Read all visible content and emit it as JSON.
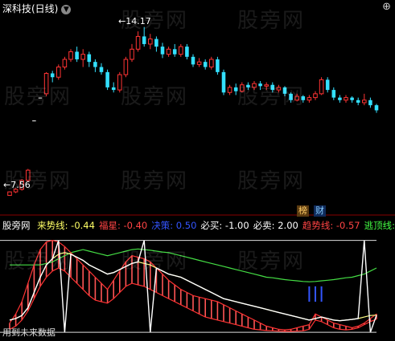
{
  "header": {
    "title": "深科技(日线)",
    "menu_icon": "chevron-down-icon"
  },
  "annotations": {
    "high_label": "14.17",
    "low_label": "7.56"
  },
  "badges": {
    "badge1": "榜",
    "badge2": "财"
  },
  "indicator": {
    "name": "股旁网",
    "values": [
      {
        "label": "来势线:",
        "value": "-0.44",
        "color": "#ffff66"
      },
      {
        "label": "福星:",
        "value": "-0.40",
        "color": "#ff4444"
      },
      {
        "label": "决策:",
        "value": "0.50",
        "color": "#3355ff"
      },
      {
        "label": "必买:",
        "value": "-1.00",
        "color": "#ffffff"
      },
      {
        "label": "必卖:",
        "value": "2.00",
        "color": "#ffffff"
      },
      {
        "label": "趋势线:",
        "value": "-0.57",
        "color": "#ff4444"
      },
      {
        "label": "逃顶线:",
        "value": "",
        "color": "#44ff44"
      }
    ]
  },
  "footer": "用到未来数据",
  "watermark": "股旁网",
  "colors": {
    "up": "#ff3333",
    "down": "#33e0ff",
    "flat": "#ffffff",
    "line_yellow": "#ffff88",
    "line_red": "#ff3333",
    "line_green": "#44dd44",
    "line_white": "#ffffff",
    "stick_blue": "#3355ff"
  },
  "chart_data": [
    {
      "type": "candlestick",
      "title": "深科技(日线)",
      "ylim": [
        7.2,
        14.6
      ],
      "annotated_high": 14.17,
      "annotated_low": 7.56,
      "candles": [
        [
          7.56,
          7.7,
          7.56,
          7.72
        ],
        [
          7.7,
          7.8,
          7.65,
          7.85
        ],
        [
          7.8,
          8.15,
          7.75,
          8.2
        ],
        [
          8.15,
          8.55,
          8.1,
          8.6
        ],
        [
          10.5,
          10.5,
          10.5,
          10.5
        ],
        [
          11.4,
          11.4,
          11.4,
          11.4
        ],
        [
          11.55,
          12.35,
          11.45,
          12.4
        ],
        [
          12.35,
          12.2,
          12.0,
          12.45
        ],
        [
          12.2,
          12.6,
          12.1,
          12.7
        ],
        [
          12.6,
          12.9,
          12.5,
          13.0
        ],
        [
          12.9,
          13.2,
          12.8,
          13.3
        ],
        [
          13.2,
          12.9,
          12.8,
          13.4
        ],
        [
          12.9,
          13.1,
          12.6,
          13.3
        ],
        [
          13.1,
          12.8,
          12.6,
          13.2
        ],
        [
          12.8,
          12.6,
          12.4,
          12.9
        ],
        [
          12.6,
          12.4,
          12.3,
          12.75
        ],
        [
          12.4,
          11.8,
          11.7,
          12.5
        ],
        [
          11.8,
          11.7,
          11.6,
          12.0
        ],
        [
          11.7,
          12.3,
          11.6,
          12.4
        ],
        [
          12.3,
          12.9,
          12.2,
          13.0
        ],
        [
          12.9,
          13.3,
          12.8,
          13.5
        ],
        [
          13.3,
          13.8,
          13.2,
          14.0
        ],
        [
          13.8,
          13.5,
          13.4,
          14.17
        ],
        [
          13.5,
          13.7,
          13.3,
          13.9
        ],
        [
          13.7,
          13.4,
          13.2,
          13.8
        ],
        [
          13.4,
          13.1,
          12.95,
          13.55
        ],
        [
          13.1,
          13.3,
          13.0,
          13.4
        ],
        [
          13.3,
          13.1,
          13.0,
          13.5
        ],
        [
          13.1,
          13.4,
          13.0,
          13.5
        ],
        [
          13.4,
          13.0,
          12.9,
          13.5
        ],
        [
          13.0,
          12.7,
          12.6,
          13.1
        ],
        [
          12.7,
          12.8,
          12.6,
          12.95
        ],
        [
          12.8,
          12.6,
          12.5,
          12.9
        ],
        [
          12.6,
          12.9,
          12.5,
          13.0
        ],
        [
          12.9,
          12.4,
          12.3,
          13.0
        ],
        [
          12.4,
          11.6,
          11.5,
          12.5
        ],
        [
          11.6,
          11.8,
          11.5,
          11.9
        ],
        [
          11.8,
          11.65,
          11.5,
          11.95
        ],
        [
          11.65,
          11.9,
          11.6,
          12.0
        ],
        [
          11.9,
          11.8,
          11.7,
          12.0
        ],
        [
          11.8,
          11.95,
          11.7,
          12.05
        ],
        [
          11.95,
          11.85,
          11.7,
          12.05
        ],
        [
          11.85,
          11.9,
          11.7,
          12.0
        ],
        [
          11.9,
          11.7,
          11.6,
          12.0
        ],
        [
          11.7,
          11.8,
          11.6,
          11.9
        ],
        [
          11.8,
          11.55,
          11.45,
          11.85
        ],
        [
          11.55,
          11.3,
          11.2,
          11.6
        ],
        [
          11.3,
          11.45,
          11.25,
          11.55
        ],
        [
          11.45,
          11.3,
          11.2,
          11.5
        ],
        [
          11.3,
          11.4,
          11.2,
          11.5
        ],
        [
          11.4,
          11.55,
          11.3,
          11.65
        ],
        [
          11.55,
          12.1,
          11.5,
          12.2
        ],
        [
          12.1,
          11.7,
          11.6,
          12.2
        ],
        [
          11.7,
          11.4,
          11.3,
          11.8
        ],
        [
          11.4,
          11.3,
          11.2,
          11.5
        ],
        [
          11.3,
          11.4,
          11.2,
          11.5
        ],
        [
          11.4,
          11.3,
          11.2,
          11.45
        ],
        [
          11.3,
          11.2,
          11.1,
          11.4
        ],
        [
          11.2,
          11.3,
          11.1,
          11.55
        ],
        [
          11.3,
          11.1,
          11.0,
          11.4
        ],
        [
          11.1,
          10.9,
          10.8,
          11.15
        ]
      ]
    },
    {
      "type": "line",
      "title": "股旁网",
      "ylim": [
        -1.1,
        2.2
      ],
      "series": [
        {
          "name": "来势线",
          "values": [
            -0.6,
            -0.55,
            -0.45,
            -0.2,
            0.3,
            0.8,
            1.2,
            1.4,
            1.55,
            1.6,
            1.55,
            1.45,
            1.35,
            1.2,
            1.1,
            1.0,
            0.9,
            0.95,
            1.05,
            1.15,
            1.25,
            1.3,
            1.25,
            1.2,
            1.1,
            1.0,
            0.9,
            0.85,
            0.8,
            0.7,
            0.6,
            0.5,
            0.4,
            0.3,
            0.2,
            0.1,
            0.05,
            0.0,
            -0.05,
            -0.1,
            -0.15,
            -0.2,
            -0.25,
            -0.3,
            -0.35,
            -0.4,
            -0.45,
            -0.5,
            -0.55,
            -0.6,
            -0.55,
            -0.5,
            -0.55,
            -0.6,
            -0.62,
            -0.6,
            -0.58,
            -0.55,
            -0.5,
            -0.45,
            -0.44
          ]
        },
        {
          "name": "福星",
          "values": [
            -0.7,
            -0.4,
            0.0,
            0.6,
            1.2,
            1.7,
            1.95,
            2.0,
            1.95,
            1.8,
            1.6,
            1.4,
            1.2,
            1.0,
            0.8,
            0.6,
            0.4,
            0.7,
            1.0,
            1.3,
            1.5,
            1.45,
            1.4,
            1.3,
            1.1,
            0.9,
            0.7,
            0.55,
            0.4,
            0.3,
            0.2,
            0.15,
            0.1,
            0.05,
            0.0,
            -0.1,
            -0.2,
            -0.3,
            -0.4,
            -0.5,
            -0.6,
            -0.7,
            -0.8,
            -0.85,
            -0.9,
            -0.92,
            -0.9,
            -0.85,
            -0.8,
            -0.75,
            -0.4,
            -0.5,
            -0.6,
            -0.7,
            -0.75,
            -0.8,
            -0.85,
            -0.8,
            -0.7,
            -0.55,
            -0.4
          ]
        },
        {
          "name": "趋势线",
          "values": [
            -0.9,
            -0.8,
            -0.6,
            -0.3,
            0.1,
            0.5,
            0.8,
            1.0,
            1.1,
            1.0,
            0.8,
            0.6,
            0.4,
            0.2,
            0.05,
            0.0,
            -0.05,
            0.1,
            0.3,
            0.5,
            0.6,
            0.55,
            0.5,
            0.4,
            0.3,
            0.2,
            0.1,
            0.0,
            -0.1,
            -0.2,
            -0.3,
            -0.4,
            -0.5,
            -0.55,
            -0.6,
            -0.65,
            -0.7,
            -0.75,
            -0.8,
            -0.85,
            -0.9,
            -0.92,
            -0.94,
            -0.95,
            -0.96,
            -0.97,
            -0.97,
            -0.96,
            -0.95,
            -0.9,
            -0.6,
            -0.65,
            -0.75,
            -0.85,
            -0.9,
            -0.92,
            -0.9,
            -0.85,
            -0.75,
            -0.65,
            -0.57
          ]
        },
        {
          "name": "逃顶线",
          "values": [
            1.2,
            1.2,
            1.2,
            1.2,
            1.2,
            1.2,
            1.25,
            1.3,
            1.4,
            1.5,
            1.6,
            1.65,
            1.7,
            1.65,
            1.6,
            1.55,
            1.5,
            1.55,
            1.6,
            1.65,
            1.7,
            1.72,
            1.7,
            1.68,
            1.65,
            1.62,
            1.6,
            1.55,
            1.5,
            1.45,
            1.4,
            1.35,
            1.3,
            1.25,
            1.2,
            1.15,
            1.1,
            1.05,
            1.0,
            0.95,
            0.9,
            0.85,
            0.8,
            0.78,
            0.75,
            0.72,
            0.7,
            0.68,
            0.66,
            0.65,
            0.66,
            0.68,
            0.7,
            0.72,
            0.75,
            0.78,
            0.8,
            0.85,
            0.9,
            1.0,
            1.1
          ]
        },
        {
          "name": "必买",
          "values": [
            -1.0,
            -1.0,
            -1.0,
            -1.0,
            -1.0,
            -1.0,
            -1.0,
            -1.0,
            -1.0,
            -1.0,
            -1.0,
            -1.0,
            -1.0,
            -1.0,
            -1.0,
            -1.0,
            -1.0,
            -1.0,
            -1.0,
            -1.0,
            -1.0,
            -1.0,
            -1.0,
            -1.0,
            -1.0,
            -1.0,
            -1.0,
            -1.0,
            -1.0,
            -1.0,
            -1.0,
            -1.0,
            -1.0,
            -1.0,
            -1.0,
            -1.0,
            -1.0,
            -1.0,
            -1.0,
            -1.0,
            -1.0,
            -1.0,
            -1.0,
            -1.0,
            -1.0,
            -1.0,
            -1.0,
            -1.0,
            -1.0,
            -1.0,
            -1.0,
            -1.0,
            -1.0,
            -1.0,
            -1.0,
            -1.0,
            -1.0,
            -1.0,
            -1.0,
            -1.0,
            -1.0
          ]
        },
        {
          "name": "必卖",
          "values": [
            2.0,
            2.0,
            2.0,
            2.0,
            2.0,
            2.0,
            2.0,
            2.0,
            2.0,
            2.0,
            2.0,
            2.0,
            2.0,
            2.0,
            2.0,
            2.0,
            2.0,
            2.0,
            2.0,
            2.0,
            2.0,
            2.0,
            2.0,
            2.0,
            2.0,
            2.0,
            2.0,
            2.0,
            2.0,
            2.0,
            2.0,
            2.0,
            2.0,
            2.0,
            2.0,
            2.0,
            2.0,
            2.0,
            2.0,
            2.0,
            2.0,
            2.0,
            2.0,
            2.0,
            2.0,
            2.0,
            2.0,
            2.0,
            2.0,
            2.0,
            2.0,
            2.0,
            2.0,
            2.0,
            2.0,
            2.0,
            2.0,
            2.0,
            2.0,
            2.0,
            2.0
          ]
        },
        {
          "name": "决策",
          "values": [
            0.5,
            0.5,
            0.5,
            0.5,
            0.5,
            0.5,
            0.5,
            0.5,
            0.5,
            0.5,
            0.5,
            0.5,
            0.5,
            0.5,
            0.5,
            0.5,
            0.5,
            0.5,
            0.5,
            0.5,
            0.5,
            0.5,
            0.5,
            0.5,
            0.5,
            0.5,
            0.5,
            0.5,
            0.5,
            0.5,
            0.5,
            0.5,
            0.5,
            0.5,
            0.5,
            0.5,
            0.5,
            0.5,
            0.5,
            0.5,
            0.5,
            0.5,
            0.5,
            0.5,
            0.5,
            0.5,
            0.5,
            0.5,
            0.5,
            0.5,
            0.5,
            0.5,
            0.5,
            0.5,
            0.5,
            0.5,
            0.5,
            0.5,
            0.5,
            0.5,
            0.5
          ]
        }
      ]
    }
  ]
}
